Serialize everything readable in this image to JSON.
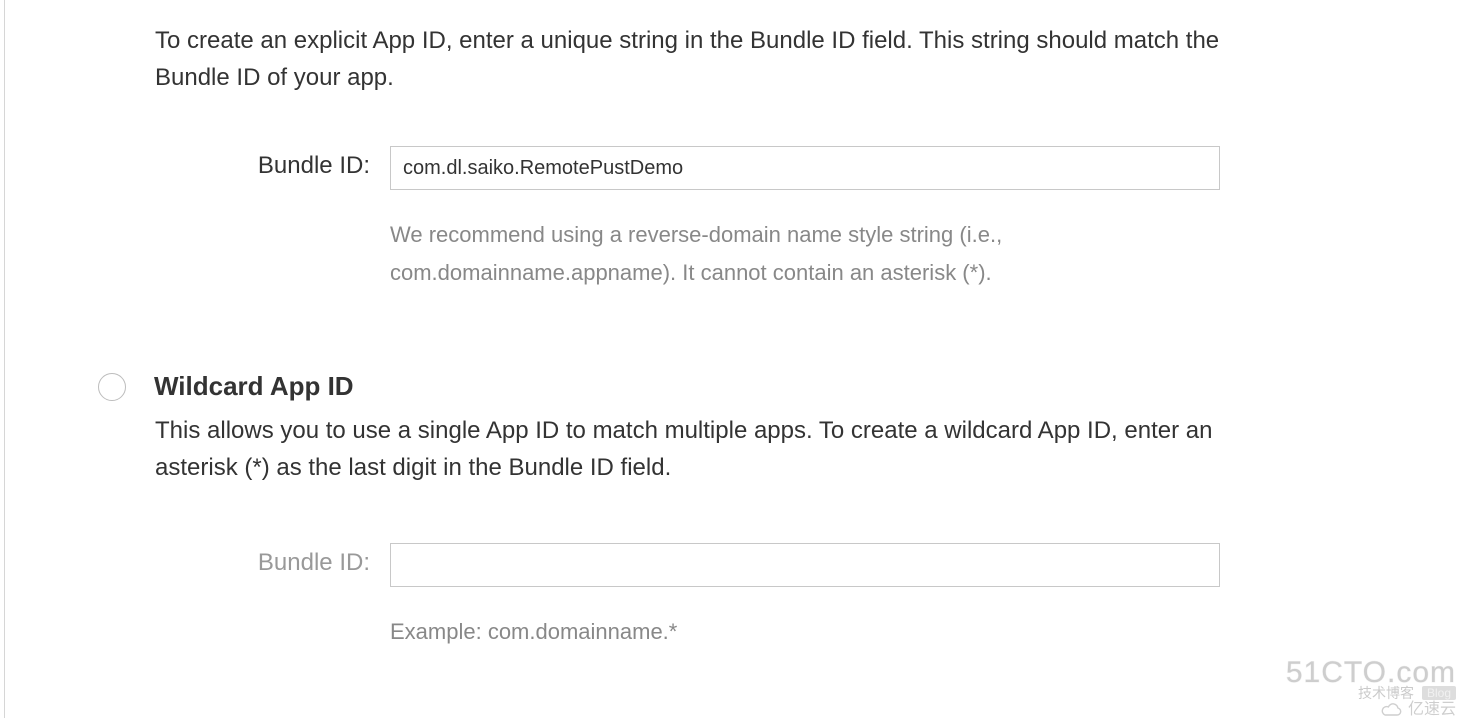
{
  "explicit": {
    "description": "To create an explicit App ID, enter a unique string in the Bundle ID field. This string should match the Bundle ID of your app.",
    "bundle_id_label": "Bundle ID:",
    "bundle_id_value": "com.dl.saiko.RemotePustDemo",
    "bundle_id_hint": "We recommend using a reverse-domain name style string (i.e., com.domainname.appname). It cannot contain an asterisk (*)."
  },
  "wildcard": {
    "title": "Wildcard App ID",
    "description": "This allows you to use a single App ID to match multiple apps. To create a wildcard App ID, enter an asterisk (*) as the last digit in the Bundle ID field.",
    "bundle_id_label": "Bundle ID:",
    "bundle_id_value": "",
    "bundle_id_hint": "Example: com.domainname.*",
    "selected": false
  },
  "watermarks": {
    "primary": "51CTO.com",
    "primary_sub_left": "技术博客",
    "primary_sub_right": "Blog",
    "secondary": "亿速云"
  }
}
